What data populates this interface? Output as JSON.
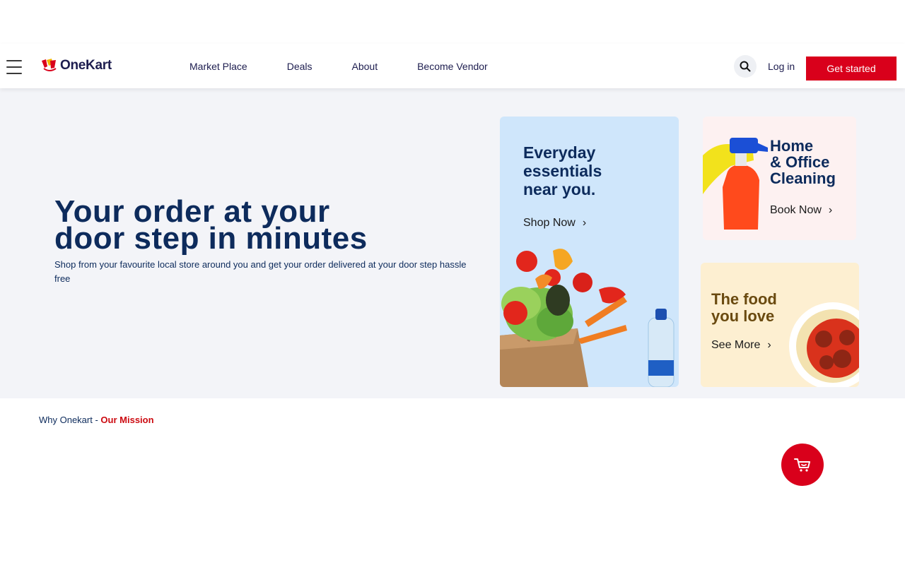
{
  "brand": {
    "name": "OneKart",
    "color": "#d9001b",
    "navy": "#0d2b5c"
  },
  "nav": {
    "items": [
      "Market Place",
      "Deals",
      "About",
      "Become Vendor"
    ]
  },
  "header_actions": {
    "login": "Log in",
    "cta": "Get started",
    "search_icon": "search-icon"
  },
  "hero": {
    "title_line1": "Your order at your",
    "title_line2": "door step in minutes",
    "subtitle": "Shop from your favourite local store around you and get your order delivered at your door step hassle free"
  },
  "cards": {
    "essentials": {
      "title_line1": "Everyday",
      "title_line2": "essentials",
      "title_line3": "near you.",
      "link": "Shop Now"
    },
    "cleaning": {
      "title_line1": "Home",
      "title_line2": "& Office",
      "title_line3": "Cleaning",
      "link": "Book Now"
    },
    "food": {
      "title_line1": "The food",
      "title_line2": "you love",
      "link": "See More"
    }
  },
  "mission": {
    "prefix": "Why Onekart - ",
    "highlight": "Our Mission"
  },
  "cart": {
    "icon": "cart-icon"
  }
}
